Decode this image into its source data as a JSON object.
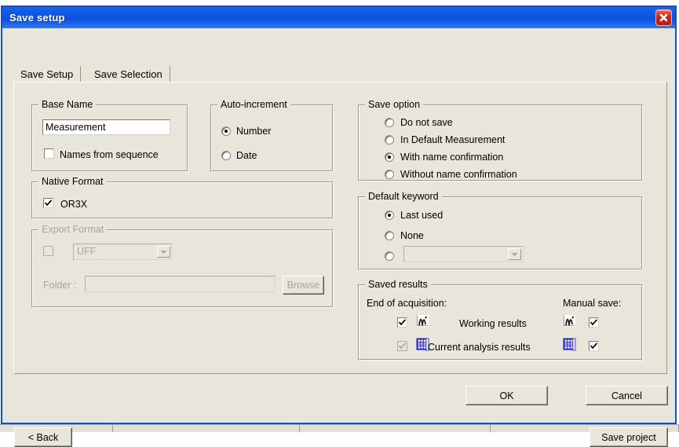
{
  "window": {
    "title": "Save setup",
    "close_icon": "close-icon"
  },
  "tabs": [
    {
      "label": "Save Setup",
      "selected": true
    },
    {
      "label": "Save Selection",
      "selected": false
    }
  ],
  "base_name": {
    "group_title": "Base Name",
    "value": "Measurement",
    "placeholder": "",
    "names_from_sequence_label": "Names from sequence",
    "names_from_sequence_checked": false
  },
  "auto_increment": {
    "group_title": "Auto-increment",
    "options": [
      {
        "label": "Number",
        "selected": true
      },
      {
        "label": "Date",
        "selected": false
      }
    ]
  },
  "native_format": {
    "group_title": "Native Format",
    "or3x_label": "OR3X",
    "or3x_checked": true
  },
  "export_format": {
    "group_title": "Export Format",
    "enabled": false,
    "checkbox_checked": false,
    "format_value": "UFF",
    "folder_label": "Folder :",
    "folder_value": "",
    "browse_label": "Browse"
  },
  "save_option": {
    "group_title": "Save option",
    "options": [
      {
        "label": "Do not save",
        "selected": false
      },
      {
        "label": "In Default Measurement",
        "selected": false
      },
      {
        "label": "With name confirmation",
        "selected": true
      },
      {
        "label": "Without name confirmation",
        "selected": false
      }
    ]
  },
  "default_keyword": {
    "group_title": "Default keyword",
    "options": [
      {
        "label": "Last used",
        "selected": true
      },
      {
        "label": "None",
        "selected": false
      },
      {
        "label": "",
        "selected": false
      }
    ],
    "combo_value": ""
  },
  "saved_results": {
    "group_title": "Saved results",
    "end_of_acquisition_label": "End of acquisition:",
    "manual_save_label": "Manual save:",
    "rows": [
      {
        "name": "Working results",
        "icon": "waveform-icon",
        "end_checked": true,
        "end_enabled": true,
        "manual_checked": true,
        "manual_enabled": true
      },
      {
        "name": "Current analysis results",
        "icon": "table-grid-icon",
        "end_checked": true,
        "end_enabled": false,
        "manual_checked": true,
        "manual_enabled": true
      }
    ]
  },
  "buttons": {
    "ok": "OK",
    "cancel": "Cancel",
    "back": "< Back",
    "save_project": "Save project"
  },
  "colors": {
    "titlebar_blue": "#0d54e2",
    "window_border": "#0a53d8",
    "dialog_bg": "#e8e6da",
    "close_red": "#cf2718",
    "icon_blue": "#2020c8",
    "disabled_text": "#a8a69a"
  }
}
